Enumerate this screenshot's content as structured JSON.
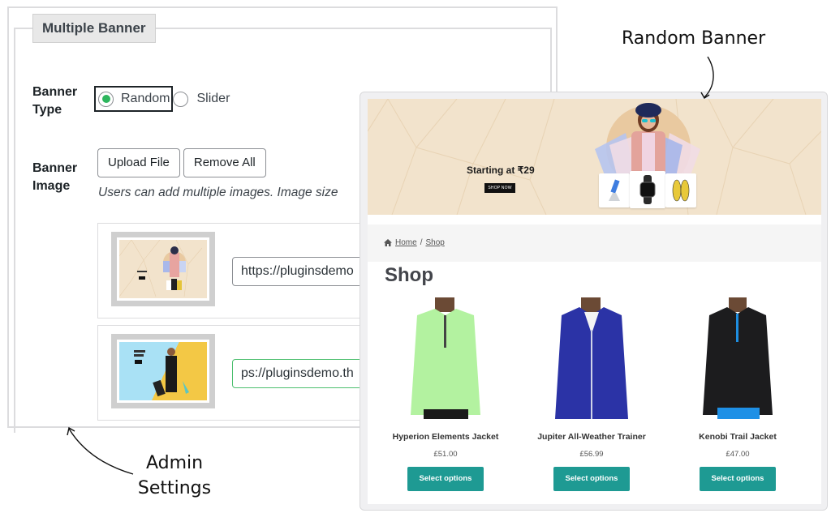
{
  "admin": {
    "section_title": "Multiple Banner",
    "banner_type_label": "Banner Type",
    "banner_type_options": [
      {
        "label": "Random",
        "checked": true
      },
      {
        "label": "Slider",
        "checked": false
      }
    ],
    "banner_image_label": "Banner Image",
    "upload_button": "Upload File",
    "remove_all_button": "Remove All",
    "help_text": "Users can add multiple images. Image size",
    "images": [
      {
        "url": "https://pluginsdemo",
        "thumbnail": "beige-shopping-banner"
      },
      {
        "url": "ps://pluginsdemo.th",
        "thumbnail": "blue-yellow-fashion-banner"
      }
    ],
    "accent_color": "#2db55d"
  },
  "shop": {
    "banner": {
      "headline": "Starting at ₹29",
      "cta": "SHOP NOW"
    },
    "breadcrumb": {
      "home": "Home",
      "separator": "/",
      "current": "Shop"
    },
    "page_title": "Shop",
    "products": [
      {
        "name": "Hyperion Elements Jacket",
        "price": "£51.00",
        "button": "Select options",
        "jacket_color": "#b3f2a0"
      },
      {
        "name": "Jupiter All-Weather Trainer",
        "price": "£56.99",
        "button": "Select options",
        "jacket_color": "#2b33a6"
      },
      {
        "name": "Kenobi Trail Jacket",
        "price": "£47.00",
        "button": "Select options",
        "jacket_color": "#1c1c1e"
      }
    ],
    "button_color": "#1e9a93"
  },
  "annotations": {
    "random_banner": "Random Banner",
    "admin_settings": "Admin Settings"
  }
}
